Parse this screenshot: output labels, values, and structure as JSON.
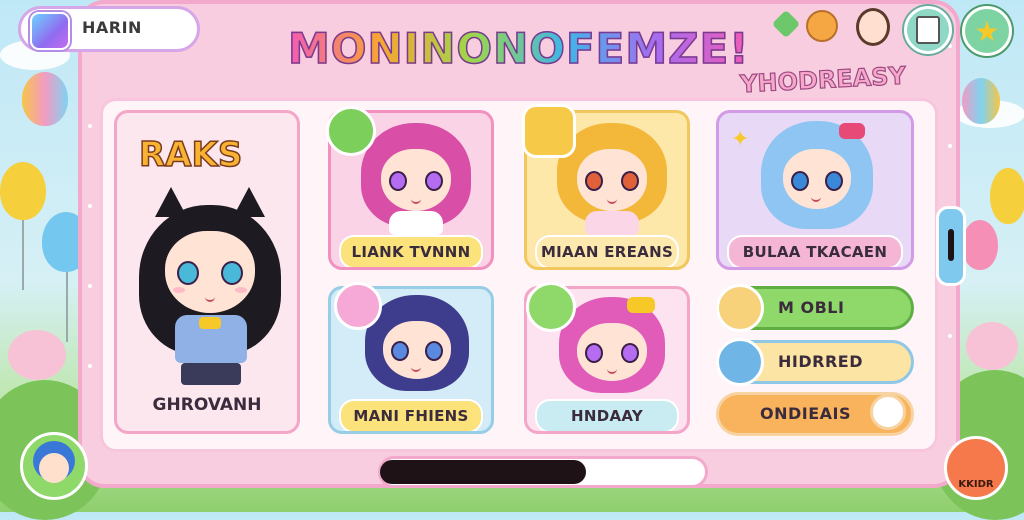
{
  "player": {
    "name": "HARIN"
  },
  "title": "MONINONOFEMZE!",
  "subtitle": "YHODREASY",
  "colors": {
    "frame": "#f9cde0",
    "accent_pink": "#f15bb5",
    "green_btn": "#8fd86a",
    "yellow_label": "#fbe27a",
    "orange_btn": "#f9b35d"
  },
  "featured": {
    "heading": "RAKS",
    "name": "GHROVANH"
  },
  "cards": [
    {
      "name": "LIANK TVNNN",
      "badge_icon": "frog-icon"
    },
    {
      "name": "MIAAN EREANS",
      "badge_icon": "star-cat-icon"
    },
    {
      "name": "BULAA TKACAEN",
      "badge_icon": "sparkle-icon"
    },
    {
      "name": "MANI FHIENS",
      "badge_icon": "smiley-icon"
    },
    {
      "name": "HNDAAY",
      "badge_icon": "gift-box-icon"
    }
  ],
  "side_buttons": [
    {
      "label": "M OBLI",
      "icon": "face-icon"
    },
    {
      "label": "HIDRRED",
      "icon": "bell-icon"
    },
    {
      "label": "ONDIEAIS",
      "icon": "ghost-icon"
    }
  ],
  "top_icons": [
    "leaf-icon",
    "bear-icon",
    "girl-avatar-icon",
    "notebook-icon",
    "star-icon"
  ],
  "bottom": {
    "left_avatar": "boy-avatar-icon",
    "right_label": "KKIDR"
  }
}
